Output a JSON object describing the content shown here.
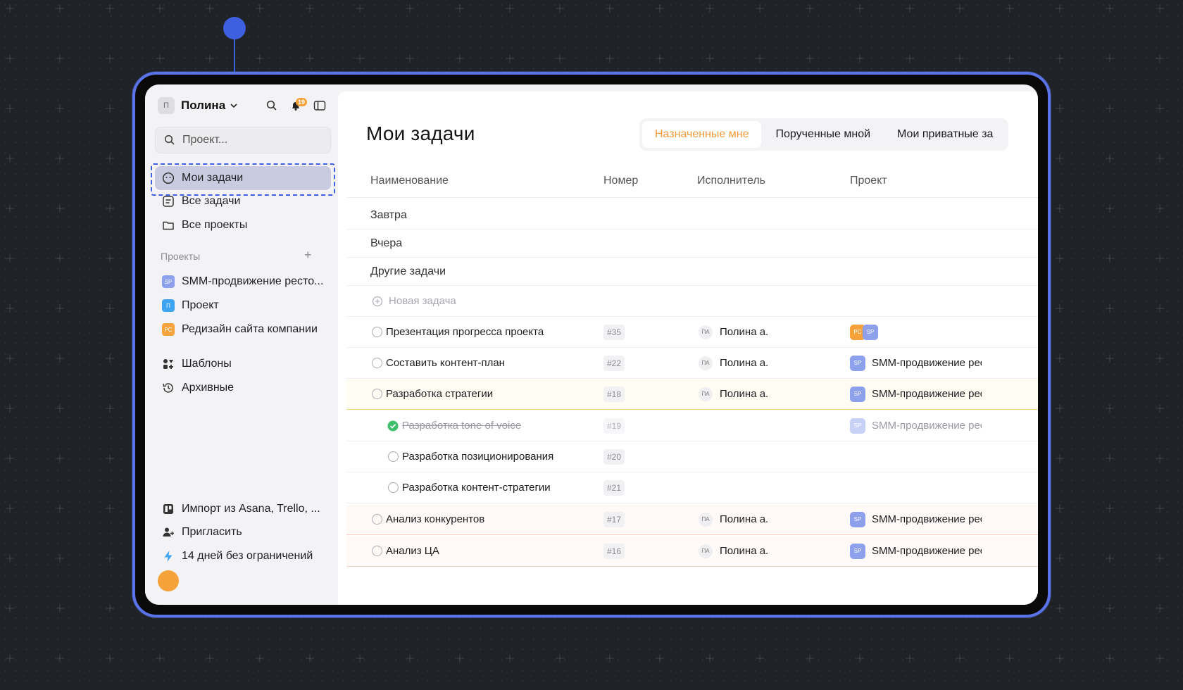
{
  "workspace": {
    "avatar_initial": "П",
    "name": "Полина",
    "notifications": "19"
  },
  "search": {
    "placeholder": "Проект..."
  },
  "nav": [
    {
      "label": "Мои задачи",
      "icon": "smile-icon",
      "active": true
    },
    {
      "label": "Все задачи",
      "icon": "list-icon"
    },
    {
      "label": "Все проекты",
      "icon": "folder-icon"
    }
  ],
  "projects_section": {
    "label": "Проекты"
  },
  "projects": [
    {
      "badge": "SP",
      "label": "SMM-продвижение ресто...",
      "color": "#8da0ec"
    },
    {
      "badge": "П",
      "label": "Проект",
      "color": "#3ea3f0"
    },
    {
      "badge": "PC",
      "label": "Редизайн сайта компании",
      "color": "#f5a23a"
    }
  ],
  "extras": [
    {
      "label": "Шаблоны",
      "icon": "templates-icon"
    },
    {
      "label": "Архивные",
      "icon": "history-icon"
    }
  ],
  "footer": [
    {
      "label": "Импорт из Asana, Trello, ...",
      "icon": "trello-icon"
    },
    {
      "label": "Пригласить",
      "icon": "invite-user-icon"
    },
    {
      "label": "14 дней без ограничений",
      "icon": "bolt-icon"
    }
  ],
  "main": {
    "title": "Мои задачи",
    "tabs": [
      {
        "label": "Назначенные мне",
        "active": true
      },
      {
        "label": "Порученные мной"
      },
      {
        "label": "Мои приватные за"
      }
    ],
    "columns": {
      "name": "Наименование",
      "number": "Номер",
      "assignee": "Исполнитель",
      "project": "Проект"
    },
    "groups": [
      {
        "label": "Завтра",
        "expanded": false
      },
      {
        "label": "Вчера",
        "expanded": false
      },
      {
        "label": "Другие задачи",
        "expanded": true
      }
    ],
    "new_task": "Новая задача",
    "tasks": [
      {
        "name": "Презентация прогресса проекта",
        "number": "#35",
        "assignee_initials": "ПА",
        "assignee": "Полина а.",
        "project_badges": [
          "PC",
          "SP"
        ],
        "project": ""
      },
      {
        "name": "Составить контент-план",
        "number": "#22",
        "assignee_initials": "ПА",
        "assignee": "Полина а.",
        "project_badge": "SP",
        "project": "SMM-продвижение ресторана"
      },
      {
        "name": "Разработка стратегии",
        "number": "#18",
        "assignee_initials": "ПА",
        "assignee": "Полина а.",
        "project_badge": "SP",
        "project": "SMM-продвижение ресторана",
        "expanded": true
      },
      {
        "name": "Разработка tone of voice",
        "number": "#19",
        "project_badge": "SP",
        "project": "SMM-продвижение ресторана",
        "done": true
      },
      {
        "name": "Разработка позиционирования",
        "number": "#20"
      },
      {
        "name": "Разработка контент-стратегии",
        "number": "#21"
      },
      {
        "name": "Анализ конкурентов",
        "number": "#17",
        "assignee_initials": "ПА",
        "assignee": "Полина а.",
        "project_badge": "SP",
        "project": "SMM-продвижение ресторана"
      },
      {
        "name": "Анализ ЦА",
        "number": "#16",
        "assignee_initials": "ПА",
        "assignee": "Полина а.",
        "project_badge": "SP",
        "project": "SMM-продвижение ресторана"
      }
    ]
  },
  "colors": {
    "accent": "#f29a3a",
    "frame": "#5b73e8",
    "selection": "#3e5fe0",
    "done": "#3fbf6a"
  }
}
